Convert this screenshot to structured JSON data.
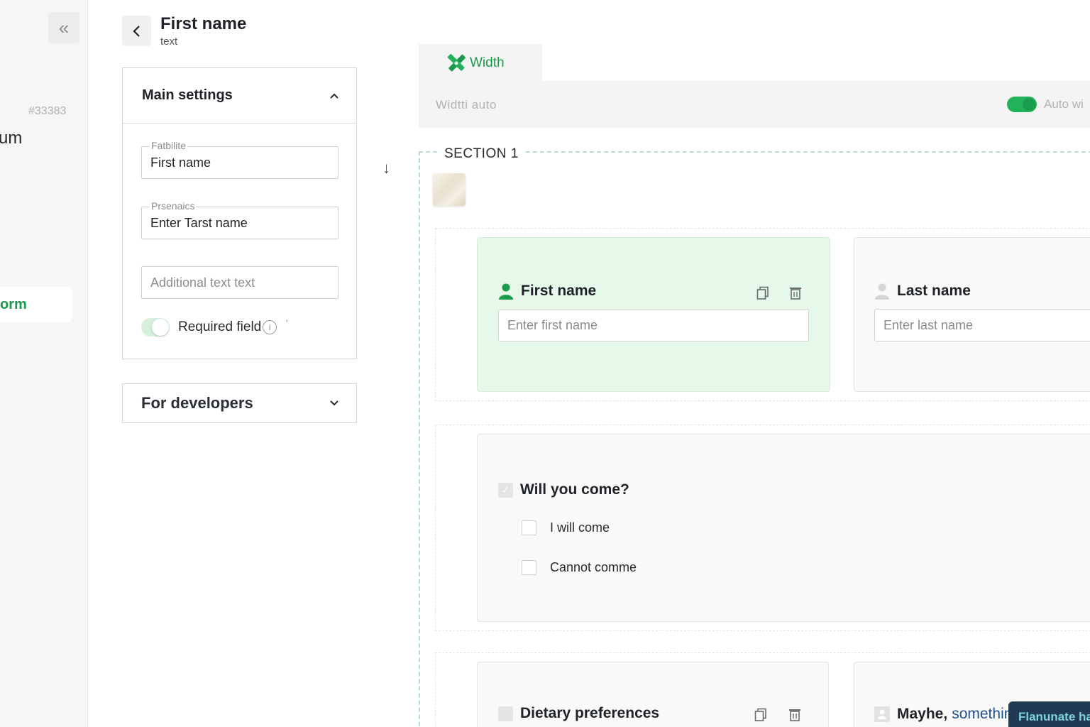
{
  "sidebar": {
    "form_id": "#33383",
    "form_name_fragment": "um",
    "active_item_fragment": "orm"
  },
  "header": {
    "field_title": "First name",
    "field_type": "text"
  },
  "main_settings": {
    "title": "Main settings",
    "field1": {
      "label": "Fatbilite",
      "value": "First name"
    },
    "field2": {
      "label": "Prsenaics",
      "value": "Enter Tarst name"
    },
    "field3": {
      "placeholder": "Additional text text"
    },
    "required": {
      "label": "Required field",
      "enabled": true,
      "info_glyph": "i",
      "mark": "''"
    }
  },
  "developers": {
    "title": "For developers"
  },
  "canvas": {
    "tab_label": "Width",
    "width_text": "Widtti  auto",
    "auto_width_label": "Auto wi",
    "section_title": "SECTION 1",
    "cards": {
      "first_name": {
        "title": "First name",
        "placeholder": "Enter first name"
      },
      "last_name": {
        "title": "Last name",
        "placeholder": "Enter last name"
      },
      "will_you_come": {
        "title": "Will you come?",
        "options": [
          "I will come",
          "Cannot comme"
        ]
      },
      "dietary": {
        "title": "Dietary preferences"
      },
      "maybe": {
        "title": "Mayhe,",
        "subtitle": "somethin"
      }
    },
    "toast": "Flanunate ha"
  },
  "colors": {
    "accent": "#1a9b4b",
    "selected_card": "#e6f8ea",
    "toggle_on": "#22b35a",
    "toast_bg": "#1f3a52"
  },
  "icons": [
    "double-chevron-left-icon",
    "chevron-left-icon",
    "chevron-up-icon",
    "chevron-down-icon",
    "info-icon",
    "arrow-down-icon",
    "width-tools-icon",
    "user-icon",
    "copy-icon",
    "trash-icon",
    "checkbox-icon"
  ]
}
